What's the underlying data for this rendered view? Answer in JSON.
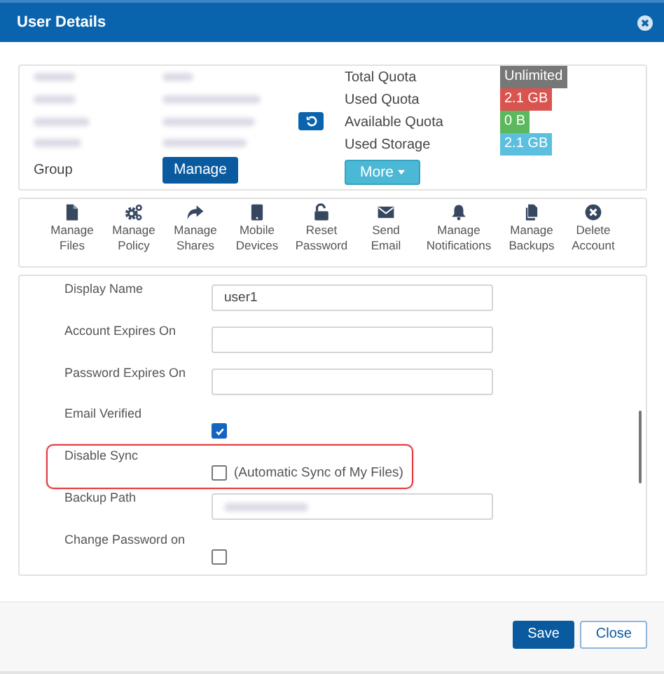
{
  "window": {
    "title": "User Details"
  },
  "info": {
    "group_label": "Group",
    "manage_button": "Manage",
    "more_button": "More",
    "quotas": [
      {
        "label": "Total Quota",
        "value": "Unlimited",
        "color": "#777777"
      },
      {
        "label": "Used Quota",
        "value": "2.1 GB",
        "color": "#d9534f"
      },
      {
        "label": "Available Quota",
        "value": "0 B",
        "color": "#5cb85c"
      },
      {
        "label": "Used Storage",
        "value": "2.1 GB",
        "color": "#5bc0de"
      }
    ]
  },
  "actions": [
    {
      "label": "Manage Files"
    },
    {
      "label": "Manage Policy"
    },
    {
      "label": "Manage Shares"
    },
    {
      "label": "Mobile Devices"
    },
    {
      "label": "Reset Password"
    },
    {
      "label": "Send Email"
    },
    {
      "label": "Manage Notifications"
    },
    {
      "label": "Manage Backups"
    },
    {
      "label": "Delete Account"
    }
  ],
  "fields": [
    {
      "kind": "input",
      "label": "Display Name",
      "value": "user1",
      "highlighted": false
    },
    {
      "kind": "input",
      "label": "Account Expires On",
      "highlighted": false
    },
    {
      "kind": "input",
      "label": "Password Expires On",
      "highlighted": false
    },
    {
      "kind": "checkbox",
      "label": "Email Verified",
      "checked": true,
      "highlighted": false
    },
    {
      "kind": "checkbox",
      "label": "Disable Sync",
      "checked": false,
      "caption": "(Automatic Sync of My Files)",
      "highlighted": true
    },
    {
      "kind": "blurred-input",
      "label": "Backup Path",
      "highlighted": false
    },
    {
      "kind": "checkbox",
      "label": "Change Password on",
      "checked": false,
      "highlighted": false
    }
  ],
  "buttons": [
    {
      "label": "Save",
      "kind": "primary"
    },
    {
      "label": "Close",
      "kind": "default"
    }
  ]
}
